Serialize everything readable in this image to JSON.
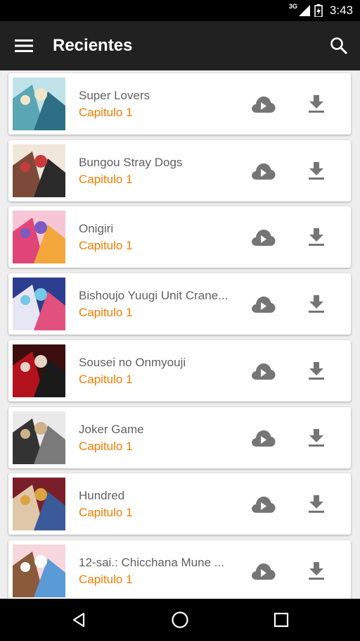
{
  "status": {
    "network": "3G",
    "time": "3:43"
  },
  "app_bar": {
    "title": "Recientes"
  },
  "items": [
    {
      "title": "Super Lovers",
      "subtitle": "Capitulo 1",
      "thumb_colors": [
        "#bfe3e8",
        "#5aa6b5",
        "#2e6f86",
        "#f2e6c9"
      ]
    },
    {
      "title": "Bungou Stray Dogs",
      "subtitle": "Capitulo 1",
      "thumb_colors": [
        "#f0e6da",
        "#7d4a3a",
        "#2a2a2a",
        "#c93a3a"
      ]
    },
    {
      "title": "Onigiri",
      "subtitle": "Capitulo 1",
      "thumb_colors": [
        "#f7c6d6",
        "#e0457a",
        "#f3a73b",
        "#7c5ac4"
      ]
    },
    {
      "title": "Bishoujo Yuugi Unit Crane...",
      "subtitle": "Capitulo 1",
      "thumb_colors": [
        "#2d3d8f",
        "#e6e6f5",
        "#e2507d",
        "#74c8e8"
      ]
    },
    {
      "title": "Sousei no Onmyouji",
      "subtitle": "Capitulo 1",
      "thumb_colors": [
        "#3b0d0d",
        "#b3121d",
        "#1a1a1a",
        "#e7d2c4"
      ]
    },
    {
      "title": "Joker Game",
      "subtitle": "Capitulo 1",
      "thumb_colors": [
        "#e9e9e9",
        "#333333",
        "#7a7a7a",
        "#d0b28a"
      ]
    },
    {
      "title": "Hundred",
      "subtitle": "Capitulo 1",
      "thumb_colors": [
        "#7a1f2a",
        "#e0c7a8",
        "#3a5a9a",
        "#d9a441"
      ]
    },
    {
      "title": "12-sai.: Chicchana Mune ...",
      "subtitle": "Capitulo 1",
      "thumb_colors": [
        "#f7d6dc",
        "#8a5a3a",
        "#5a9ad6",
        "#ffffff"
      ]
    }
  ],
  "colors": {
    "accent": "#f57c00",
    "app_bar": "#212121",
    "title_text": "#616161",
    "icon": "#757575"
  },
  "icons": {
    "menu": "hamburger-menu-icon",
    "search": "search-icon",
    "stream": "cloud-play-icon",
    "download": "download-icon",
    "nav_back": "triangle-back-icon",
    "nav_home": "circle-home-icon",
    "nav_recents": "square-recents-icon"
  }
}
